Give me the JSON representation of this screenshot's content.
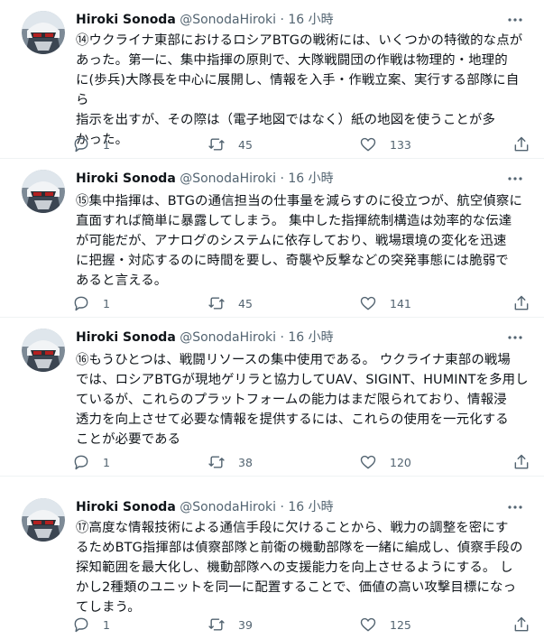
{
  "colors": {
    "text": "#0f1419",
    "muted": "#536471",
    "divider": "#eff3f4"
  },
  "icons": {
    "reply": "reply-icon",
    "retweet": "retweet-icon",
    "like": "heart-icon",
    "share": "share-icon",
    "more": "more-icon"
  },
  "tweets": [
    {
      "name": "Hiroki Sonoda",
      "handle": "@SonodaHiroki",
      "dot": "·",
      "time": "16 小時",
      "lines": [
        "⑭ウクライナ東部におけるロシアBTGの戦術には、いくつかの特徴的な点が",
        "あった。第一に、集中指揮の原則で、大隊戦闘団の作戦は物理的・地理的",
        "に(歩兵)大隊長を中心に展開し、情報を入手・作戦立案、実行する部隊に自ら",
        "指示を出すが、その際は（電子地図ではなく）紙の地図を使うことが多",
        "かった。"
      ],
      "replies": "1",
      "retweets": "45",
      "likes": "133"
    },
    {
      "name": "Hiroki Sonoda",
      "handle": "@SonodaHiroki",
      "dot": "·",
      "time": "16 小時",
      "lines": [
        "⑮集中指揮は、BTGの通信担当の仕事量を減らすのに役立つが、航空偵察に",
        "直面すれば簡単に暴露してしまう。 集中した指揮統制構造は効率的な伝達",
        "が可能だが、アナログのシステムに依存しており、戦場環境の変化を迅速",
        "に把握・対応するのに時間を要し、奇襲や反撃などの突発事態には脆弱で",
        "あると言える。"
      ],
      "replies": "1",
      "retweets": "45",
      "likes": "141"
    },
    {
      "name": "Hiroki Sonoda",
      "handle": "@SonodaHiroki",
      "dot": "·",
      "time": "16 小時",
      "lines": [
        "⑯もうひとつは、戦闘リソースの集中使用である。 ウクライナ東部の戦場",
        "では、ロシアBTGが現地ゲリラと協力してUAV、SIGINT、HUMINTを多用し",
        "ているが、これらのプラットフォームの能力はまだ限られており、情報浸",
        "透力を向上させて必要な情報を提供するには、これらの使用を一元化する",
        "ことが必要である"
      ],
      "replies": "1",
      "retweets": "38",
      "likes": "120"
    },
    {
      "name": "Hiroki Sonoda",
      "handle": "@SonodaHiroki",
      "dot": "·",
      "time": "16 小時",
      "lines": [
        "⑰高度な情報技術による通信手段に欠けることから、戦力の調整を密にす",
        "るためBTG指揮部は偵察部隊と前衛の機動部隊を一緒に編成し、偵察手段の",
        "探知範囲を最大化し、機動部隊への支援能力を向上させるようにする。 し",
        "かし2種類のユニットを同一に配置することで、価値の高い攻撃目標になっ",
        "てしまう。"
      ],
      "replies": "1",
      "retweets": "39",
      "likes": "125"
    }
  ]
}
